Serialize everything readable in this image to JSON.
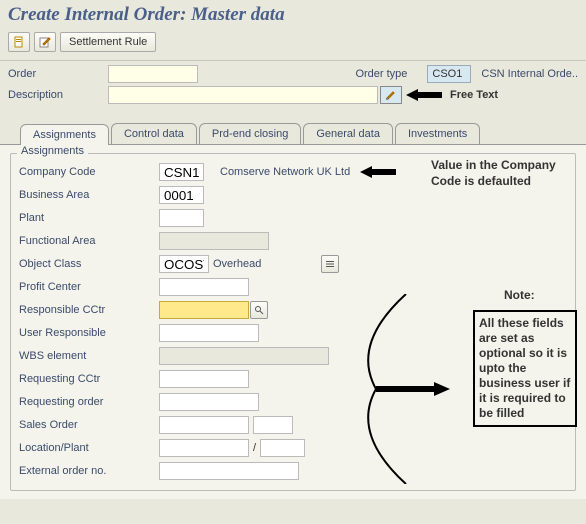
{
  "title": "Create Internal Order: Master data",
  "toolbar": {
    "settlement_rule": "Settlement Rule"
  },
  "header": {
    "order_label": "Order",
    "order_value": "",
    "order_type_label": "Order type",
    "order_type_value": "CSO1",
    "order_type_desc": "CSN Internal Orde..",
    "description_label": "Description",
    "description_value": "",
    "free_text": "Free Text"
  },
  "tabs": [
    {
      "label": "Assignments",
      "active": true
    },
    {
      "label": "Control data",
      "active": false
    },
    {
      "label": "Prd-end closing",
      "active": false
    },
    {
      "label": "General data",
      "active": false
    },
    {
      "label": "Investments",
      "active": false
    }
  ],
  "group_title": "Assignments",
  "fields": {
    "company_code": {
      "label": "Company Code",
      "value": "CSN1",
      "desc": "Comserve Network UK Ltd"
    },
    "business_area": {
      "label": "Business Area",
      "value": "0001"
    },
    "plant": {
      "label": "Plant",
      "value": ""
    },
    "functional_area": {
      "label": "Functional Area",
      "value": ""
    },
    "object_class": {
      "label": "Object Class",
      "value": "OCOST",
      "desc": "Overhead"
    },
    "profit_center": {
      "label": "Profit Center",
      "value": ""
    },
    "responsible_cctr": {
      "label": "Responsible CCtr",
      "value": ""
    },
    "user_responsible": {
      "label": "User Responsible",
      "value": ""
    },
    "wbs_element": {
      "label": "WBS element",
      "value": ""
    },
    "requesting_cctr": {
      "label": "Requesting CCtr",
      "value": ""
    },
    "requesting_order": {
      "label": "Requesting order",
      "value": ""
    },
    "sales_order": {
      "label": "Sales Order",
      "value": "",
      "item": ""
    },
    "location_plant": {
      "label": "Location/Plant",
      "value1": "",
      "value2": "",
      "sep": "/"
    },
    "external_order": {
      "label": "External order no.",
      "value": ""
    }
  },
  "annotations": {
    "company_code_note": "Value in the Company Code is defaulted",
    "note_title": "Note:",
    "note_body": "All these fields are set as optional so it is upto the business user if it is required to be filled"
  }
}
